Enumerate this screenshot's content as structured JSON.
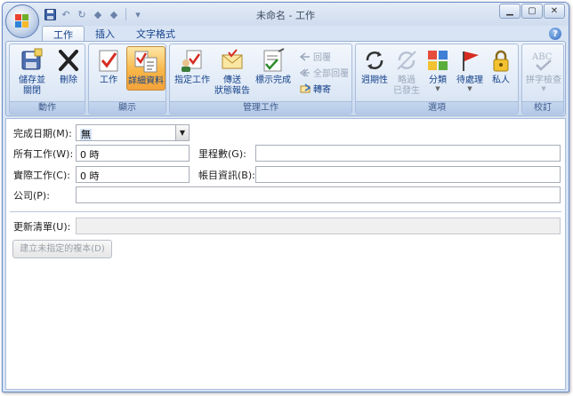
{
  "window": {
    "title": "未命名 - 工作"
  },
  "qat": {
    "icons": [
      "save-icon",
      "undo-icon",
      "redo-icon",
      "up-icon",
      "down-icon",
      "customize-icon"
    ]
  },
  "tabs": [
    {
      "label": "工作",
      "active": true
    },
    {
      "label": "插入",
      "active": false
    },
    {
      "label": "文字格式",
      "active": false
    }
  ],
  "ribbon": {
    "groups": {
      "actions": {
        "label": "動作",
        "save_close": "儲存並\n關閉",
        "delete": "刪除"
      },
      "show": {
        "label": "顯示",
        "task": "工作",
        "details": "詳細資料"
      },
      "manage": {
        "label": "管理工作",
        "assign": "指定工作",
        "send_status": "傳送\n狀態報告",
        "mark_complete": "標示完成",
        "reply": "回覆",
        "reply_all": "全部回覆",
        "forward": "轉寄"
      },
      "options": {
        "label": "選項",
        "recurrence": "週期性",
        "skip": "略過\n已發生",
        "categorize": "分類",
        "follow_up": "待處理",
        "private": "私人"
      },
      "proofing": {
        "label": "校訂",
        "spelling": "拼字檢查"
      }
    }
  },
  "form": {
    "date_completed_label": "完成日期(M):",
    "date_completed_value": "無",
    "total_work_label": "所有工作(W):",
    "total_work_value": "0 時",
    "actual_work_label": "實際工作(C):",
    "actual_work_value": "0 時",
    "mileage_label": "里程數(G):",
    "mileage_value": "",
    "billing_label": "帳目資訊(B):",
    "billing_value": "",
    "company_label": "公司(P):",
    "company_value": "",
    "update_list_label": "更新清單(U):",
    "update_list_value": "",
    "create_copy_button": "建立未指定的複本(D)"
  },
  "colors": {
    "ribbon_bg": "#d5e2f3",
    "accent": "#15428b",
    "selected": "#f8b648"
  }
}
